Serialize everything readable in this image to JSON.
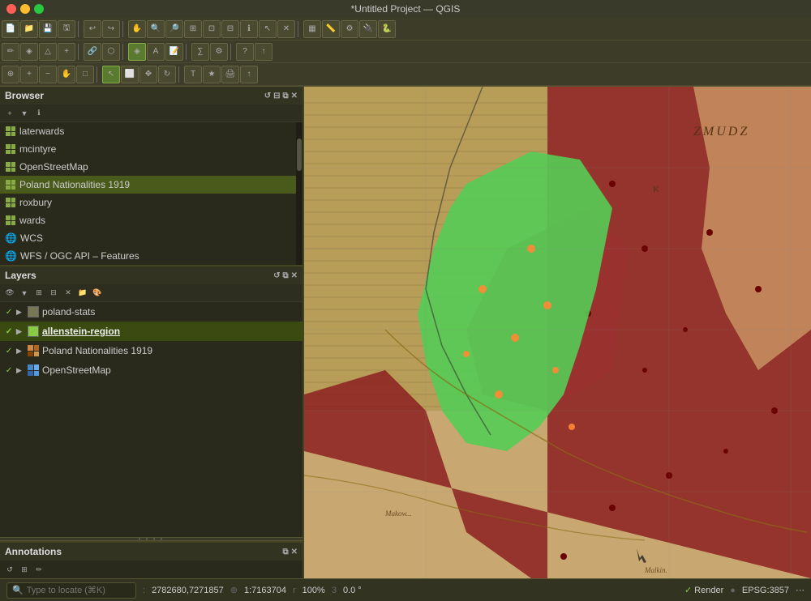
{
  "titlebar": {
    "title": "*Untitled Project — QGIS"
  },
  "browser": {
    "title": "Browser",
    "items": [
      {
        "label": "laterwards",
        "type": "layer"
      },
      {
        "label": "mcintyre",
        "type": "layer"
      },
      {
        "label": "OpenStreetMap",
        "type": "layer"
      },
      {
        "label": "Poland Nationalities 1919",
        "type": "layer"
      },
      {
        "label": "roxbury",
        "type": "layer"
      },
      {
        "label": "wards",
        "type": "layer"
      },
      {
        "label": "WCS",
        "type": "service"
      },
      {
        "label": "WFS / OGC API – Features",
        "type": "service"
      }
    ]
  },
  "layers": {
    "title": "Layers",
    "items": [
      {
        "label": "poland-stats",
        "checked": true,
        "type": "vector",
        "color": "#555555"
      },
      {
        "label": "allenstein-region",
        "checked": true,
        "type": "vector",
        "color": "#88cc44",
        "highlighted": true
      },
      {
        "label": "Poland Nationalities 1919",
        "checked": true,
        "type": "raster",
        "color": "#cc8844"
      },
      {
        "label": "OpenStreetMap",
        "checked": true,
        "type": "raster",
        "color": "#4488cc"
      }
    ]
  },
  "annotations": {
    "title": "Annotations"
  },
  "statusbar": {
    "search_placeholder": "Type to locate (⌘K)",
    "coordinates": "2782680,7271857",
    "scale_icon": "⊕",
    "scale": "1:7163704",
    "rotation_icon": "r",
    "rotation": "100%",
    "angle_icon": "3",
    "angle": "0.0 °",
    "render_label": "Render",
    "epsg": "EPSG:3857"
  }
}
